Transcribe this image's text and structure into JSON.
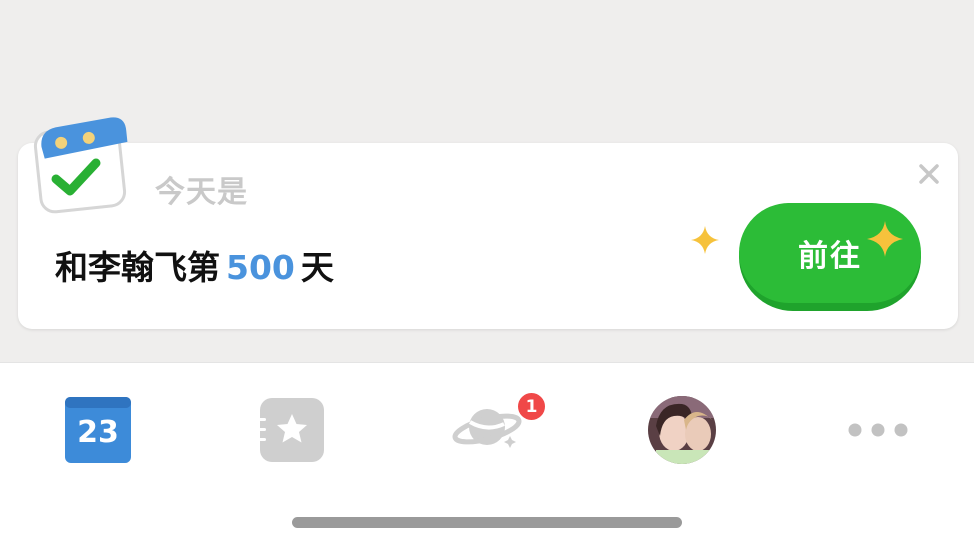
{
  "card": {
    "today_label": "今天是",
    "anniversary_prefix": "和李翰飞第",
    "anniversary_number": "500",
    "anniversary_suffix": "天",
    "go_button_label": "前往",
    "close_icon": "close-icon",
    "calendar_icon": "calendar-check-icon"
  },
  "tabbar": {
    "calendar_day": "23",
    "planet_badge_count": "1",
    "tabs": [
      "calendar-icon",
      "favorites-star-icon",
      "planet-icon",
      "avatar",
      "more-icon"
    ]
  },
  "colors": {
    "highlight_number": "#4a93dd",
    "go_button": "#2cbc37",
    "calendar_tab": "#3d8bd9",
    "badge": "#f04848",
    "sparkle": "#f6c23c"
  }
}
